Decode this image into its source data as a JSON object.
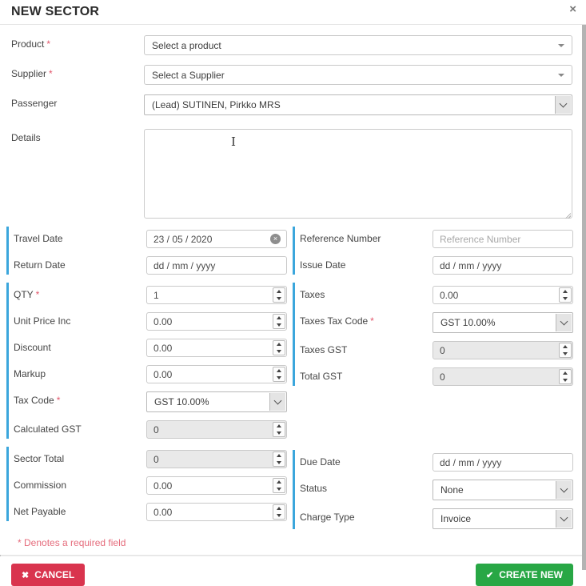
{
  "modal": {
    "title": "NEW SECTOR"
  },
  "icons": {
    "close": "×",
    "clear": "×",
    "cancel": "✖",
    "create": "✔"
  },
  "colors": {
    "accent_blue": "#3ba6dc",
    "danger_red": "#d9344e",
    "success_green": "#28a745",
    "required_red": "#e2566b",
    "disabled_bg": "#e9e9e9"
  },
  "top": {
    "product": {
      "label": "Product",
      "required": "*",
      "value": "Select a product"
    },
    "supplier": {
      "label": "Supplier",
      "required": "*",
      "value": "Select a Supplier"
    },
    "passenger": {
      "label": "Passenger",
      "value": "(Lead) SUTINEN, Pirkko MRS"
    },
    "details": {
      "label": "Details",
      "value": ""
    }
  },
  "left": {
    "travel_date": {
      "label": "Travel Date",
      "value": "23 / 05 / 2020"
    },
    "return_date": {
      "label": "Return Date",
      "value": "dd / mm / yyyy"
    },
    "qty": {
      "label": "QTY",
      "required": "*",
      "value": "1"
    },
    "unit_price_inc": {
      "label": "Unit Price Inc",
      "value": "0.00"
    },
    "discount": {
      "label": "Discount",
      "value": "0.00"
    },
    "markup": {
      "label": "Markup",
      "value": "0.00"
    },
    "tax_code": {
      "label": "Tax Code",
      "required": "*",
      "value": "GST 10.00%"
    },
    "calculated_gst": {
      "label": "Calculated GST",
      "value": "0"
    },
    "sector_total": {
      "label": "Sector Total",
      "value": "0"
    },
    "commission": {
      "label": "Commission",
      "value": "0.00"
    },
    "net_payable": {
      "label": "Net Payable",
      "value": "0.00"
    }
  },
  "right": {
    "reference_number": {
      "label": "Reference Number",
      "placeholder": "Reference Number"
    },
    "issue_date": {
      "label": "Issue Date",
      "value": "dd / mm / yyyy"
    },
    "taxes": {
      "label": "Taxes",
      "value": "0.00"
    },
    "taxes_tax_code": {
      "label": "Taxes Tax Code",
      "required": "*",
      "value": "GST 10.00%"
    },
    "taxes_gst": {
      "label": "Taxes GST",
      "value": "0"
    },
    "total_gst": {
      "label": "Total GST",
      "value": "0"
    },
    "due_date": {
      "label": "Due Date",
      "value": "dd / mm / yyyy"
    },
    "status": {
      "label": "Status",
      "value": "None"
    },
    "charge_type": {
      "label": "Charge Type",
      "value": "Invoice"
    }
  },
  "footer": {
    "required_note": "* Denotes a required field",
    "cancel_label": "CANCEL",
    "create_label": "CREATE NEW"
  }
}
